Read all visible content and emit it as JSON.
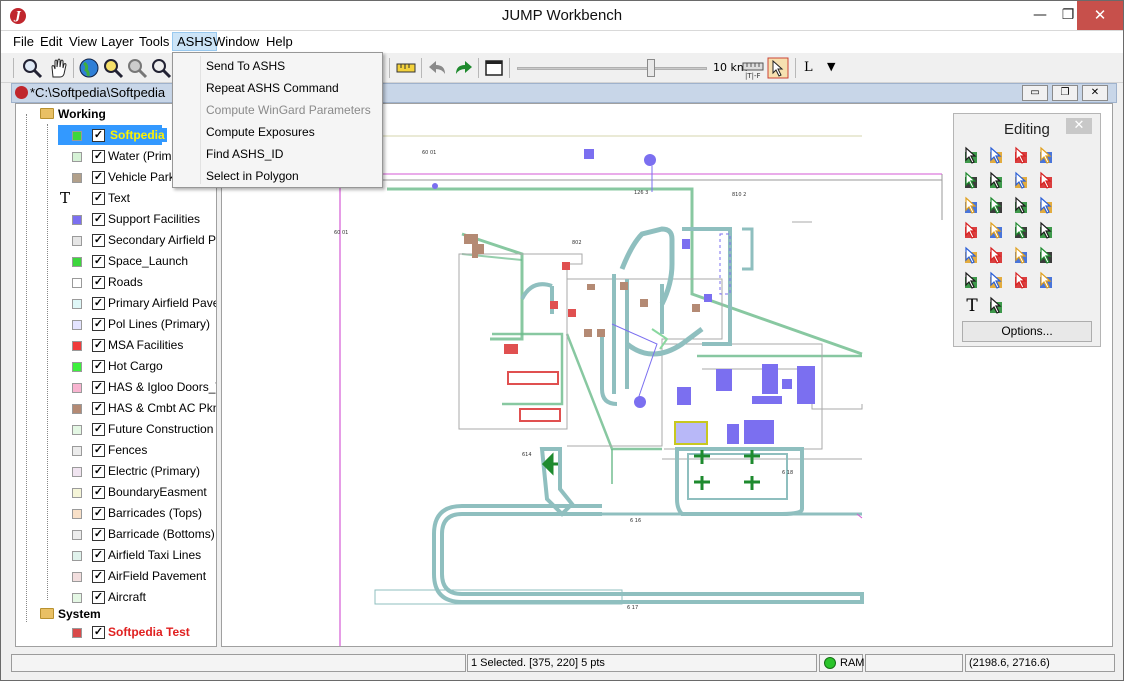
{
  "window": {
    "title": "JUMP Workbench",
    "minimize_glyph": "—",
    "maximize_glyph": "❐",
    "close_glyph": "✕"
  },
  "menubar": {
    "items": [
      {
        "label": "File"
      },
      {
        "label": "Edit"
      },
      {
        "label": "View"
      },
      {
        "label": "Layer"
      },
      {
        "label": "Tools"
      },
      {
        "label": "ASHS"
      },
      {
        "label": "Window"
      },
      {
        "label": "Help"
      }
    ],
    "active": "ASHS"
  },
  "toolbar": {
    "scale_label": "10 km",
    "scale_sub": "|T|-F",
    "l_label": "L",
    "dropdown_glyph": "▼",
    "icons": [
      "zoom-icon",
      "pan-icon",
      "globe-icon",
      "zoom-in-icon",
      "zoom-out-icon",
      "zoom-to-selection-icon",
      "measure-icon",
      "undo-icon",
      "redo-icon",
      "window-icon",
      "scale-ruler-icon",
      "select-tool-icon"
    ]
  },
  "ashs_menu": {
    "items": [
      {
        "label": "Send To ASHS",
        "enabled": true
      },
      {
        "label": "Repeat ASHS Command",
        "enabled": true
      },
      {
        "label": "Compute WinGard Parameters",
        "enabled": false
      },
      {
        "label": "Compute Exposures",
        "enabled": true
      },
      {
        "label": "Find ASHS_ID",
        "enabled": true
      },
      {
        "label": "Select in Polygon",
        "enabled": true
      }
    ]
  },
  "document": {
    "tab_title": "*C:\\Softpedia\\Softpedia",
    "minimize_glyph": "▭",
    "restore_glyph": "❐",
    "close_glyph": "✕"
  },
  "layers": {
    "categories": [
      {
        "name": "Working",
        "layers": [
          {
            "name": "Softpedia",
            "color": "#3dd63d",
            "checked": true,
            "selected": true
          },
          {
            "name": "Water (Primar",
            "color": "#d6f2d6",
            "checked": true
          },
          {
            "name": "Vehicle Parkin",
            "color": "#b2a08a",
            "checked": true
          },
          {
            "name": "Text",
            "color": "",
            "checked": true,
            "text_icon": "T"
          },
          {
            "name": "Support Facilities",
            "color": "#7b6ff0",
            "checked": true
          },
          {
            "name": "Secondary Airfield Pav",
            "color": "#e6e6e6",
            "checked": true
          },
          {
            "name": "Space_Launch",
            "color": "#3dd63d",
            "checked": true
          },
          {
            "name": "Roads",
            "color": "#ffffff",
            "checked": true
          },
          {
            "name": "Primary Airfield Pavem",
            "color": "#dff7f7",
            "checked": true
          },
          {
            "name": "Pol Lines (Primary)",
            "color": "#e4e4ff",
            "checked": true
          },
          {
            "name": "MSA Facilities",
            "color": "#f03c3c",
            "checked": true
          },
          {
            "name": "Hot Cargo",
            "color": "#3df03d",
            "checked": true
          },
          {
            "name": "HAS & Igloo Doors_Ver",
            "color": "#f8b4d0",
            "checked": true
          },
          {
            "name": "HAS & Cmbt AC Pkng",
            "color": "#b48a74",
            "checked": true
          },
          {
            "name": "Future Construction",
            "color": "#e4f7e4",
            "checked": true
          },
          {
            "name": "Fences",
            "color": "#ececec",
            "checked": true
          },
          {
            "name": "Electric (Primary)",
            "color": "#f0e4f0",
            "checked": true
          },
          {
            "name": "BoundaryEasment",
            "color": "#f5f5d8",
            "checked": true
          },
          {
            "name": "Barricades (Tops)",
            "color": "#f8e0c8",
            "checked": true
          },
          {
            "name": "Barricade (Bottoms)",
            "color": "#ececec",
            "checked": true
          },
          {
            "name": "Airfield Taxi Lines",
            "color": "#e0f2ec",
            "checked": true
          },
          {
            "name": "AirField Pavement",
            "color": "#f2dede",
            "checked": true
          },
          {
            "name": "Aircraft",
            "color": "#e4f7e4",
            "checked": true
          }
        ]
      },
      {
        "name": "System",
        "layers": [
          {
            "name": "Softpedia Test",
            "color": "#d94a4a",
            "checked": true,
            "red": true
          }
        ]
      }
    ],
    "check_glyph": "✓"
  },
  "editing_toolbox": {
    "title": "Editing",
    "close_glyph": "✕",
    "options_label": "Options...",
    "text_tool_glyph": "T",
    "tools": [
      "select-features-icon",
      "select-parts-icon",
      "select-line-strings-icon",
      "select-one-item-icon",
      "draw-rectangle-icon",
      "draw-polygon-icon",
      "draw-line-string-icon",
      "draw-point-icon",
      "move-vertex-icon",
      "insert-vertex-icon",
      "delete-vertex-icon",
      "snap-vertices-icon",
      "move-features-icon",
      "delete-features-icon",
      "rotate-icon",
      "fill-icon",
      "add-vertex-icon",
      "remove-vertex-icon",
      "split-line-icon",
      "join-line-icon",
      "collapse-icon",
      "expand-icon",
      "fan-icon",
      "extract-icon",
      "text-tool-icon",
      "annotate-icon"
    ]
  },
  "statusbar": {
    "message": "",
    "selection": "1 Selected. [375, 220] 5 pts",
    "ram_label": "RAM",
    "memory": "",
    "coordinates": "(2198.6, 2716.6)"
  }
}
